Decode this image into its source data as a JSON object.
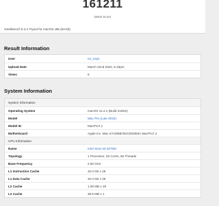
{
  "score": {
    "value": "161211",
    "label": "Metal Score",
    "note": "Geekbench 5.4.4 Tryout for macOS x86 (64-bit)"
  },
  "result_information": {
    "title": "Result Information",
    "rows": [
      {
        "key": "User",
        "value": "mr_zeye"
      },
      {
        "key": "Upload Date",
        "value": "March 22nd 2022, 5:15pm"
      },
      {
        "key": "Views",
        "value": "5"
      }
    ]
  },
  "system_information": {
    "title": "System Information",
    "system_header": "System Information",
    "system_rows": [
      {
        "key": "Operating System",
        "value": "macOS 12.2.1 (Build 21D62)"
      },
      {
        "key": "Model",
        "value": "Mac Pro (Late 2019)"
      },
      {
        "key": "Model ID",
        "value": "MacPro7,1"
      },
      {
        "key": "Motherboard",
        "value": "Apple Inc. Mac-27ADBB7B4CEE8E61 MacPro7,1"
      }
    ],
    "cpu_header": "CPU Information",
    "cpu_rows": [
      {
        "key": "Name",
        "value": "Intel Xeon W-3275M"
      },
      {
        "key": "Topology",
        "value": "1 Processor, 28 Cores, 56 Threads"
      },
      {
        "key": "Base Frequency",
        "value": "2.50 GHz"
      },
      {
        "key": "L1 Instruction Cache",
        "value": "32.0 KB x 28"
      },
      {
        "key": "L1 Data Cache",
        "value": "32.0 KB x 28"
      },
      {
        "key": "L2 Cache",
        "value": "1.00 MB x 28"
      },
      {
        "key": "L3 Cache",
        "value": "38.5 MB x 1"
      }
    ]
  },
  "colors": {
    "link": "#2a6fc9",
    "background": "#eeeeee",
    "card": "#ffffff"
  }
}
